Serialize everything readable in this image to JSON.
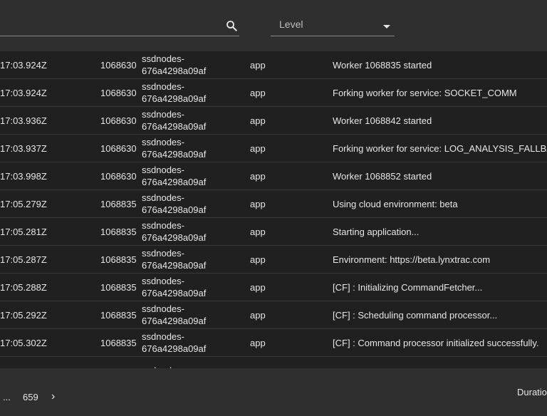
{
  "toolbar": {
    "search_value": "",
    "level_label": "Level"
  },
  "rows": [
    {
      "time": "17:03.924Z",
      "pid": "1068630",
      "host1": "ssdnodes-",
      "host2": "676a4298a09af",
      "source": "app",
      "message": "Worker 1068835 started"
    },
    {
      "time": "17:03.924Z",
      "pid": "1068630",
      "host1": "ssdnodes-",
      "host2": "676a4298a09af",
      "source": "app",
      "message": "Forking worker for service: SOCKET_COMM"
    },
    {
      "time": "17:03.936Z",
      "pid": "1068630",
      "host1": "ssdnodes-",
      "host2": "676a4298a09af",
      "source": "app",
      "message": "Worker 1068842 started"
    },
    {
      "time": "17:03.937Z",
      "pid": "1068630",
      "host1": "ssdnodes-",
      "host2": "676a4298a09af",
      "source": "app",
      "message": "Forking worker for service: LOG_ANALYSIS_FALLBAC"
    },
    {
      "time": "17:03.998Z",
      "pid": "1068630",
      "host1": "ssdnodes-",
      "host2": "676a4298a09af",
      "source": "app",
      "message": "Worker 1068852 started"
    },
    {
      "time": "17:05.279Z",
      "pid": "1068835",
      "host1": "ssdnodes-",
      "host2": "676a4298a09af",
      "source": "app",
      "message": "Using cloud environment: beta"
    },
    {
      "time": "17:05.281Z",
      "pid": "1068835",
      "host1": "ssdnodes-",
      "host2": "676a4298a09af",
      "source": "app",
      "message": "Starting application..."
    },
    {
      "time": "17:05.287Z",
      "pid": "1068835",
      "host1": "ssdnodes-",
      "host2": "676a4298a09af",
      "source": "app",
      "message": "Environment: https://beta.lynxtrac.com"
    },
    {
      "time": "17:05.288Z",
      "pid": "1068835",
      "host1": "ssdnodes-",
      "host2": "676a4298a09af",
      "source": "app",
      "message": "[CF] : Initializing CommandFetcher..."
    },
    {
      "time": "17:05.292Z",
      "pid": "1068835",
      "host1": "ssdnodes-",
      "host2": "676a4298a09af",
      "source": "app",
      "message": "[CF] : Scheduling command processor..."
    },
    {
      "time": "17:05.302Z",
      "pid": "1068835",
      "host1": "ssdnodes-",
      "host2": "676a4298a09af",
      "source": "app",
      "message": "[CF] : Command processor initialized successfully."
    },
    {
      "time": "",
      "pid": "",
      "host1": "ssdnodes-",
      "host2": "",
      "source": "",
      "message": ""
    }
  ],
  "pagination": {
    "ellipsis": "...",
    "last_page": "659",
    "next_glyph": "›"
  },
  "footer": {
    "duration_label": "Duration"
  }
}
